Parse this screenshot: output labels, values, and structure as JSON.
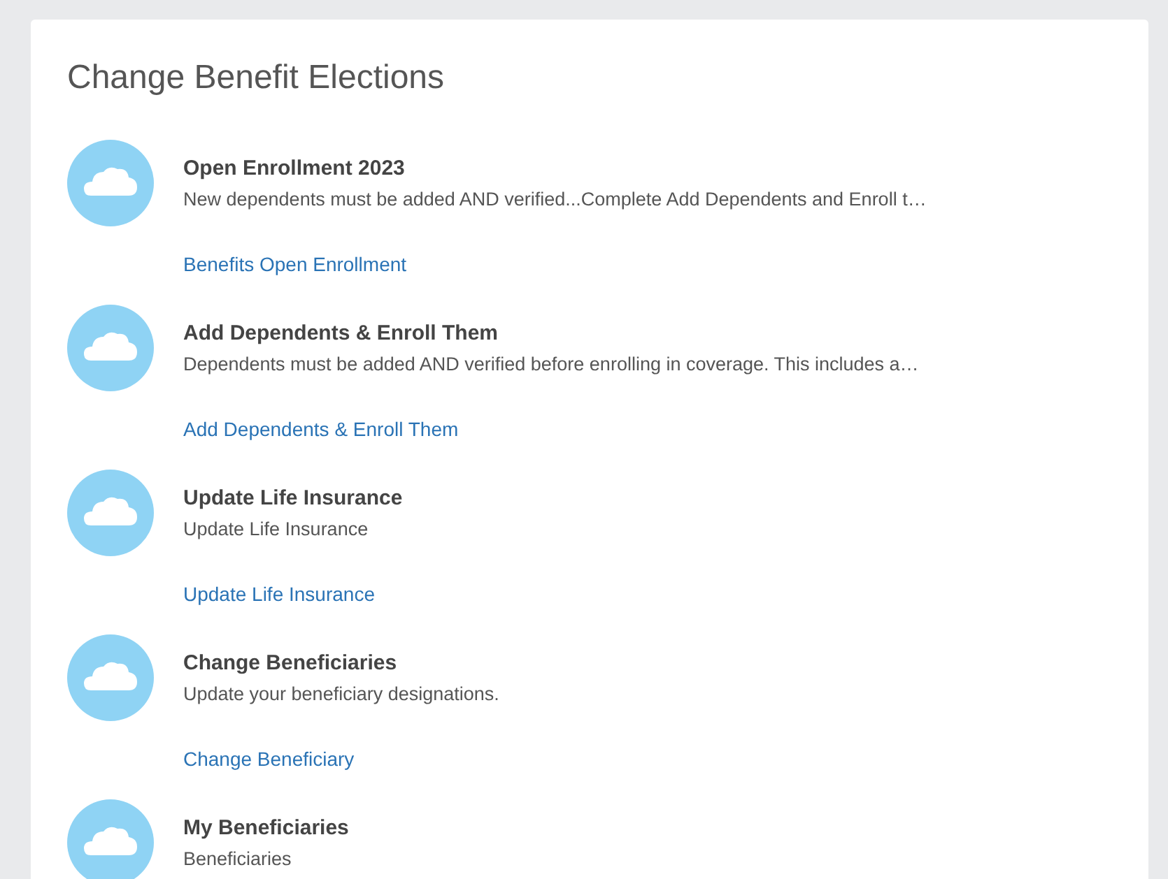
{
  "card": {
    "title": "Change Benefit Elections",
    "items": [
      {
        "title": "Open Enrollment 2023",
        "description": "New dependents must be added AND verified...Complete Add Dependents and Enroll t…",
        "link": "Benefits Open Enrollment"
      },
      {
        "title": "Add Dependents & Enroll Them",
        "description": "Dependents must be added AND verified before enrolling in coverage. This includes a…",
        "link": "Add Dependents & Enroll Them"
      },
      {
        "title": "Update Life Insurance",
        "description": "Update Life Insurance",
        "link": "Update Life Insurance"
      },
      {
        "title": "Change Beneficiaries",
        "description": "Update your beneficiary designations.",
        "link": "Change Beneficiary"
      },
      {
        "title": "My Beneficiaries",
        "description": "Beneficiaries"
      }
    ]
  }
}
